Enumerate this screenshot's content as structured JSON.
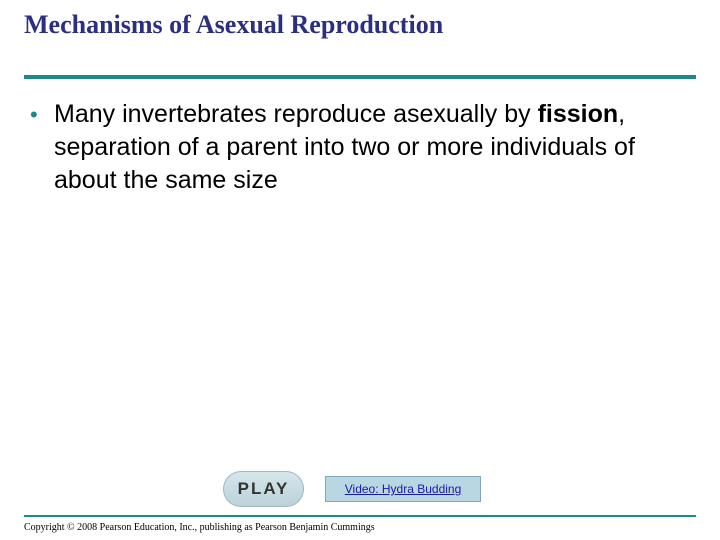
{
  "slide": {
    "title": "Mechanisms of Asexual Reproduction",
    "bullet": {
      "marker": "•",
      "text_before": "Many invertebrates reproduce asexually by ",
      "emphasis": "fission",
      "text_after": ", separation of a parent into two or more individuals of about the same size"
    }
  },
  "media": {
    "play_label": "PLAY",
    "video_link_label": "Video: Hydra Budding"
  },
  "footer": {
    "copyright": "Copyright © 2008 Pearson Education, Inc., publishing as Pearson Benjamin Cummings"
  },
  "colors": {
    "title": "#2b2e83",
    "rule": "#1a8a8c",
    "link": "#1a1aa8"
  }
}
